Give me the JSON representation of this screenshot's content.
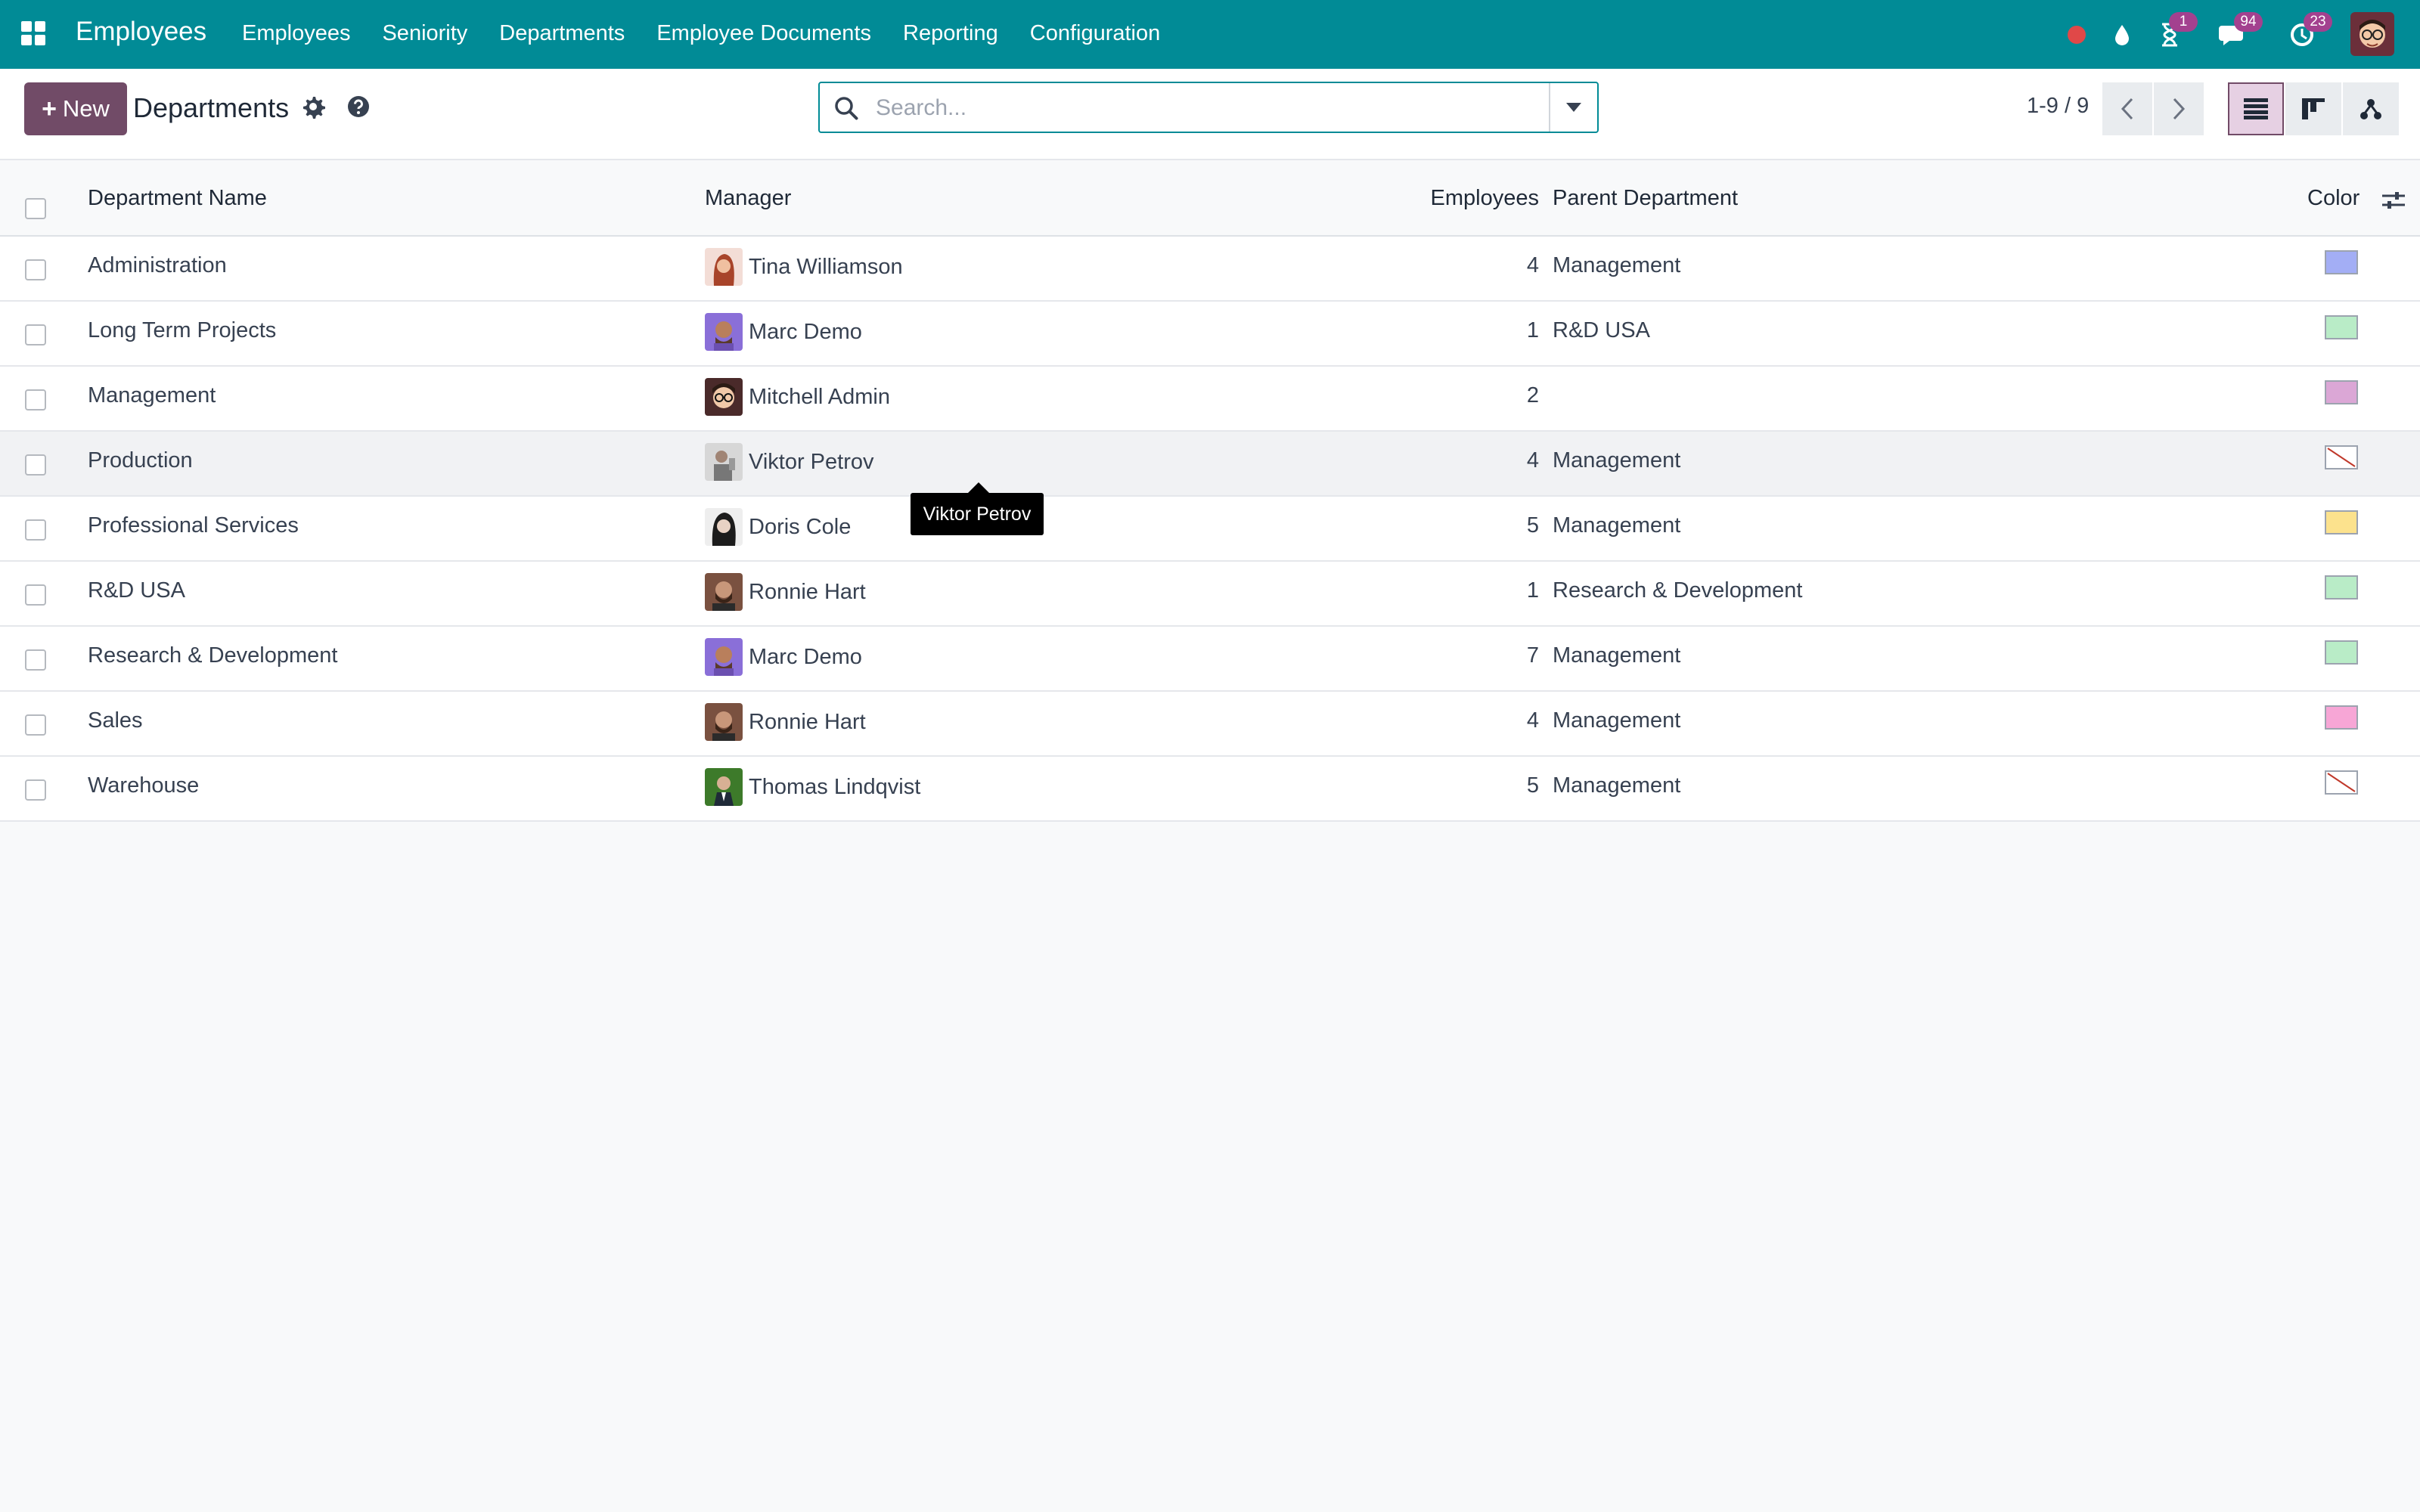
{
  "navbar": {
    "app_name": "Employees",
    "menu": [
      "Employees",
      "Seniority",
      "Departments",
      "Employee Documents",
      "Reporting",
      "Configuration"
    ],
    "activity_badge": "1",
    "messages_badge": "94",
    "timer_badge": "23"
  },
  "control": {
    "new_label": "New",
    "title": "Departments",
    "search_placeholder": "Search...",
    "pager": "1-9 / 9"
  },
  "table": {
    "headers": {
      "name": "Department Name",
      "manager": "Manager",
      "employees": "Employees",
      "parent": "Parent Department",
      "color": "Color"
    },
    "rows": [
      {
        "name": "Administration",
        "manager": "Tina Williamson",
        "employees": "4",
        "parent": "Management",
        "color": "#a3aef5",
        "avatar": "woman"
      },
      {
        "name": "Long Term Projects",
        "manager": "Marc Demo",
        "employees": "1",
        "parent": "R&D USA",
        "color": "#b9ecc7",
        "avatar": "purple-man"
      },
      {
        "name": "Management",
        "manager": "Mitchell Admin",
        "employees": "2",
        "parent": "",
        "color": "#dba7d6",
        "avatar": "admin"
      },
      {
        "name": "Production",
        "manager": "Viktor Petrov",
        "employees": "4",
        "parent": "Management",
        "color": "none",
        "avatar": "grey-man"
      },
      {
        "name": "Professional Services",
        "manager": "Doris Cole",
        "employees": "5",
        "parent": "Management",
        "color": "#fce28d",
        "avatar": "dark-woman"
      },
      {
        "name": "R&D USA",
        "manager": "Ronnie Hart",
        "employees": "1",
        "parent": "Research & Development",
        "color": "#b9ecc7",
        "avatar": "beard-man"
      },
      {
        "name": "Research & Development",
        "manager": "Marc Demo",
        "employees": "7",
        "parent": "Management",
        "color": "#b9ecc7",
        "avatar": "purple-man"
      },
      {
        "name": "Sales",
        "manager": "Ronnie Hart",
        "employees": "4",
        "parent": "Management",
        "color": "#f7a6d6",
        "avatar": "beard-man"
      },
      {
        "name": "Warehouse",
        "manager": "Thomas Lindqvist",
        "employees": "5",
        "parent": "Management",
        "color": "none",
        "avatar": "green-man"
      }
    ]
  },
  "tooltip": "Viktor Petrov"
}
